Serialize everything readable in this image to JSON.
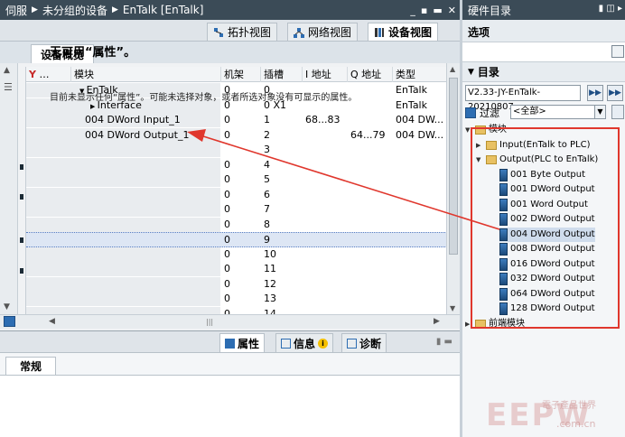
{
  "breadcrumb": {
    "root": "伺服",
    "group": "未分组的设备",
    "device": "EnTalk [EnTalk]"
  },
  "view_tabs": [
    {
      "label": "拓扑视图",
      "icon": "topology-icon"
    },
    {
      "label": "网络视图",
      "icon": "network-icon"
    },
    {
      "label": "设备视图",
      "icon": "device-icon",
      "active": true
    }
  ],
  "overview_tab": "设备概览",
  "grid": {
    "columns": [
      "模块",
      "机架",
      "插槽",
      "I 地址",
      "Q 地址",
      "类型"
    ],
    "rows": [
      {
        "module": "EnTalk",
        "rack": "0",
        "slot": "0",
        "i_addr": "",
        "q_addr": "",
        "type": "EnTalk",
        "indent": 1,
        "tri": "▼"
      },
      {
        "module": "Interface",
        "rack": "0",
        "slot": "0 X1",
        "i_addr": "",
        "q_addr": "",
        "type": "EnTalk",
        "indent": 2,
        "tri": "▶"
      },
      {
        "module": "004 DWord Input_1",
        "rack": "0",
        "slot": "1",
        "i_addr": "68...83",
        "q_addr": "",
        "type": "004 DW...",
        "indent": 1,
        "tri": ""
      },
      {
        "module": "004 DWord Output_1",
        "rack": "0",
        "slot": "2",
        "i_addr": "",
        "q_addr": "64...79",
        "type": "004 DW...",
        "indent": 1,
        "tri": ""
      },
      {
        "module": "",
        "rack": "",
        "slot": "3",
        "i_addr": "",
        "q_addr": "",
        "type": "",
        "indent": 0,
        "tri": ""
      },
      {
        "module": "",
        "rack": "0",
        "slot": "4",
        "i_addr": "",
        "q_addr": "",
        "type": "",
        "indent": 0,
        "tri": ""
      },
      {
        "module": "",
        "rack": "0",
        "slot": "5",
        "i_addr": "",
        "q_addr": "",
        "type": "",
        "indent": 0,
        "tri": ""
      },
      {
        "module": "",
        "rack": "0",
        "slot": "6",
        "i_addr": "",
        "q_addr": "",
        "type": "",
        "indent": 0,
        "tri": ""
      },
      {
        "module": "",
        "rack": "0",
        "slot": "7",
        "i_addr": "",
        "q_addr": "",
        "type": "",
        "indent": 0,
        "tri": ""
      },
      {
        "module": "",
        "rack": "0",
        "slot": "8",
        "i_addr": "",
        "q_addr": "",
        "type": "",
        "indent": 0,
        "tri": ""
      },
      {
        "module": "",
        "rack": "0",
        "slot": "9",
        "i_addr": "",
        "q_addr": "",
        "type": "",
        "indent": 0,
        "tri": "",
        "selected": true
      },
      {
        "module": "",
        "rack": "0",
        "slot": "10",
        "i_addr": "",
        "q_addr": "",
        "type": "",
        "indent": 0,
        "tri": ""
      },
      {
        "module": "",
        "rack": "0",
        "slot": "11",
        "i_addr": "",
        "q_addr": "",
        "type": "",
        "indent": 0,
        "tri": ""
      },
      {
        "module": "",
        "rack": "0",
        "slot": "12",
        "i_addr": "",
        "q_addr": "",
        "type": "",
        "indent": 0,
        "tri": ""
      },
      {
        "module": "",
        "rack": "0",
        "slot": "13",
        "i_addr": "",
        "q_addr": "",
        "type": "",
        "indent": 0,
        "tri": ""
      },
      {
        "module": "",
        "rack": "0",
        "slot": "14",
        "i_addr": "",
        "q_addr": "",
        "type": "",
        "indent": 0,
        "tri": ""
      }
    ]
  },
  "properties": {
    "tabs": [
      {
        "label": "属性",
        "icon": "properties-icon",
        "active": true
      },
      {
        "label": "信息",
        "icon": "info-icon"
      },
      {
        "label": "诊断",
        "icon": "diagnostics-icon"
      }
    ],
    "general_tab": "常规",
    "title": "无可用“属性”。",
    "desc": "目前未显示任何“属性”。可能未选择对象，或者所选对象没有可显示的属性。"
  },
  "catalog": {
    "panel_title": "硬件目录",
    "options_label": "选项",
    "catalog_label": "目录",
    "search_value": "V2.33-JY-EnTalk-20210807",
    "filter_label": "过滤",
    "filter_select": "<全部>",
    "tree": [
      {
        "label": "模块",
        "type": "folder",
        "tri": "▼",
        "level": 0
      },
      {
        "label": "Input(EnTalk to PLC)",
        "type": "folder",
        "tri": "▶",
        "level": 1
      },
      {
        "label": "Output(PLC to EnTalk)",
        "type": "folder",
        "tri": "▼",
        "level": 1
      },
      {
        "label": "001 Byte Output",
        "type": "module",
        "level": 2
      },
      {
        "label": "001 DWord Output",
        "type": "module",
        "level": 2
      },
      {
        "label": "001 Word Output",
        "type": "module",
        "level": 2
      },
      {
        "label": "002 DWord Output",
        "type": "module",
        "level": 2
      },
      {
        "label": "004 DWord Output",
        "type": "module",
        "level": 2,
        "selected": true
      },
      {
        "label": "008 DWord Output",
        "type": "module",
        "level": 2
      },
      {
        "label": "016 DWord Output",
        "type": "module",
        "level": 2
      },
      {
        "label": "032 DWord Output",
        "type": "module",
        "level": 2
      },
      {
        "label": "064 DWord Output",
        "type": "module",
        "level": 2
      },
      {
        "label": "128 DWord Output",
        "type": "module",
        "level": 2
      },
      {
        "label": "前端模块",
        "type": "folder",
        "tri": "▶",
        "level": 0
      }
    ]
  },
  "watermark": {
    "logo": "EEPW",
    "sub": "電子產品世界",
    "url": ".com.cn"
  },
  "colors": {
    "titlebar": "#3b4b57",
    "highlight": "#e0372d",
    "selection": "#dde6f4"
  }
}
